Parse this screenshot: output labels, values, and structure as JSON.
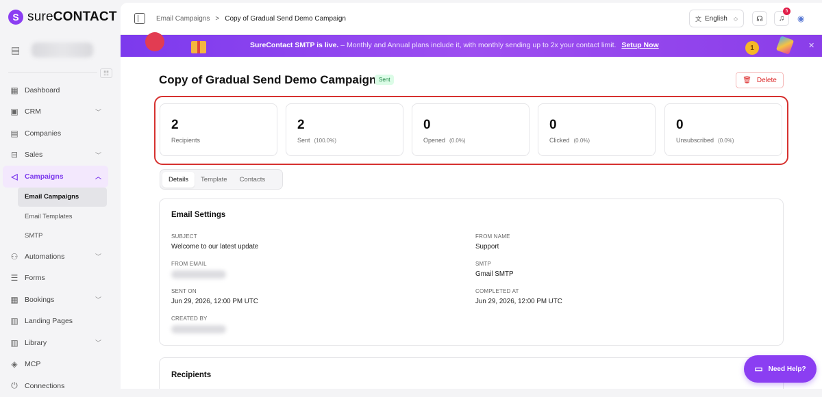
{
  "brand": {
    "mark": "S",
    "name_light": "sure",
    "name_bold": "CONTACT"
  },
  "sidebar": {
    "items": [
      {
        "label": "Dashboard",
        "icon": "dashboard-icon",
        "glyph": "▦",
        "chevron": false
      },
      {
        "label": "CRM",
        "icon": "contact-card-icon",
        "glyph": "▣",
        "chevron": true
      },
      {
        "label": "Companies",
        "icon": "building-icon",
        "glyph": "▤",
        "chevron": false
      },
      {
        "label": "Sales",
        "icon": "briefcase-icon",
        "glyph": "⊟",
        "chevron": true
      },
      {
        "label": "Campaigns",
        "icon": "megaphone-icon",
        "glyph": "◁",
        "chevron": true,
        "active": true
      },
      {
        "label": "Automations",
        "icon": "workflow-icon",
        "glyph": "⚇",
        "chevron": true
      },
      {
        "label": "Forms",
        "icon": "form-icon",
        "glyph": "☰",
        "chevron": false
      },
      {
        "label": "Bookings",
        "icon": "calendar-icon",
        "glyph": "▦",
        "chevron": true
      },
      {
        "label": "Landing Pages",
        "icon": "layout-icon",
        "glyph": "▥",
        "chevron": false
      },
      {
        "label": "Library",
        "icon": "library-icon",
        "glyph": "▥",
        "chevron": true
      },
      {
        "label": "MCP",
        "icon": "mcp-icon",
        "glyph": "◈",
        "chevron": false
      },
      {
        "label": "Connections",
        "icon": "plug-icon",
        "glyph": "⏻",
        "chevron": false
      }
    ],
    "campaign_sub": [
      "Email Campaigns",
      "Email Templates",
      "SMTP"
    ]
  },
  "topbar": {
    "crumb_parent": "Email Campaigns",
    "crumb_sep": ">",
    "crumb_current": "Copy of Gradual Send Demo Campaign",
    "language": "English",
    "notif_count": "5"
  },
  "banner": {
    "strong": "SureContact SMTP is live.",
    "text": " – Monthly and Annual plans include it, with monthly sending up to 2x your contact limit.",
    "link": "Setup Now",
    "medal": "1"
  },
  "campaign": {
    "title": "Copy of Gradual Send Demo Campaign",
    "status": "Sent",
    "delete_label": "Delete"
  },
  "stats": [
    {
      "value": "2",
      "label": "Recipients",
      "pct": ""
    },
    {
      "value": "2",
      "label": "Sent",
      "pct": "(100.0%)"
    },
    {
      "value": "0",
      "label": "Opened",
      "pct": "(0.0%)"
    },
    {
      "value": "0",
      "label": "Clicked",
      "pct": "(0.0%)"
    },
    {
      "value": "0",
      "label": "Unsubscribed",
      "pct": "(0.0%)"
    }
  ],
  "tabs": [
    "Details",
    "Template",
    "Contacts"
  ],
  "settings": {
    "title": "Email Settings",
    "subject_label": "SUBJECT",
    "subject": "Welcome to our latest update",
    "from_name_label": "FROM NAME",
    "from_name": "Support",
    "from_email_label": "FROM EMAIL",
    "smtp_label": "SMTP",
    "smtp": "Gmail SMTP",
    "sent_on_label": "SENT ON",
    "sent_on": "Jun 29, 2026, 12:00 PM UTC",
    "completed_label": "COMPLETED AT",
    "completed": "Jun 29, 2026, 12:00 PM UTC",
    "created_by_label": "CREATED BY"
  },
  "recipients_title": "Recipients",
  "help_label": "Need Help?",
  "colors": {
    "accent": "#8b3ef2",
    "highlight": "#d6312f",
    "sent_badge": "#15803d"
  }
}
